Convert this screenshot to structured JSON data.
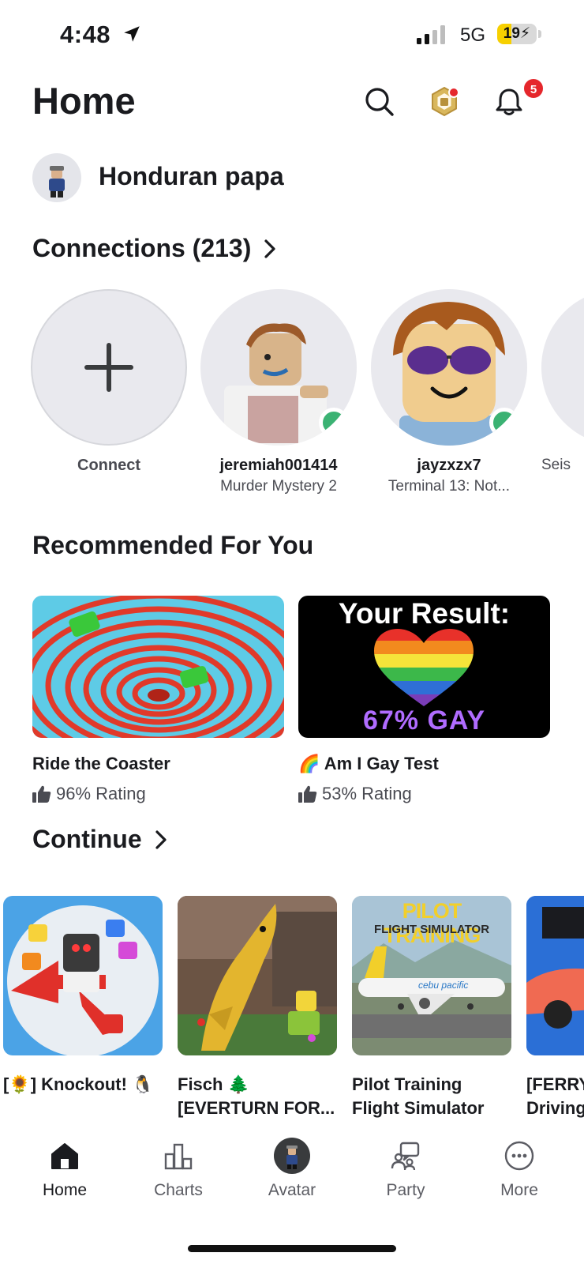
{
  "status_bar": {
    "time": "4:48",
    "network": "5G",
    "battery": "19",
    "battery_level": 0.19
  },
  "header": {
    "title": "Home",
    "notifications_count": "5"
  },
  "profile": {
    "name": "Honduran papa"
  },
  "connections": {
    "title": "Connections (213)",
    "connect_label": "Connect",
    "items": [
      {
        "name": "jeremiah001414",
        "status": "Murder Mystery 2"
      },
      {
        "name": "jayzxzx7",
        "status": "Terminal 13: Not..."
      },
      {
        "name": "",
        "status": "Seis"
      }
    ]
  },
  "recommended": {
    "title": "Recommended For You",
    "items": [
      {
        "title": "Ride the Coaster",
        "rating": "96% Rating"
      },
      {
        "emoji": "🌈",
        "title": "Am I Gay Test",
        "rating": "53% Rating",
        "thumb_heading": "Your Result:",
        "thumb_result": "67% GAY"
      }
    ]
  },
  "continue": {
    "title": "Continue",
    "items": [
      {
        "line1": "[🌻] Knockout! 🐧",
        "line2": ""
      },
      {
        "line1": "Fisch 🌲",
        "line2": "[EVERTURN FOR..."
      },
      {
        "line1": "Pilot Training",
        "line2": "Flight Simulator",
        "thumb_heading": "PILOT TRAINING",
        "thumb_sub": "FLIGHT SIMULATOR",
        "thumb_livery": "cebu pacific"
      },
      {
        "line1": "[FERRY",
        "line2": "Driving"
      }
    ]
  },
  "bottom_nav": [
    {
      "label": "Home",
      "icon": "home-icon"
    },
    {
      "label": "Charts",
      "icon": "charts-icon"
    },
    {
      "label": "Avatar",
      "icon": "avatar-icon"
    },
    {
      "label": "Party",
      "icon": "party-icon"
    },
    {
      "label": "More",
      "icon": "more-icon"
    }
  ]
}
